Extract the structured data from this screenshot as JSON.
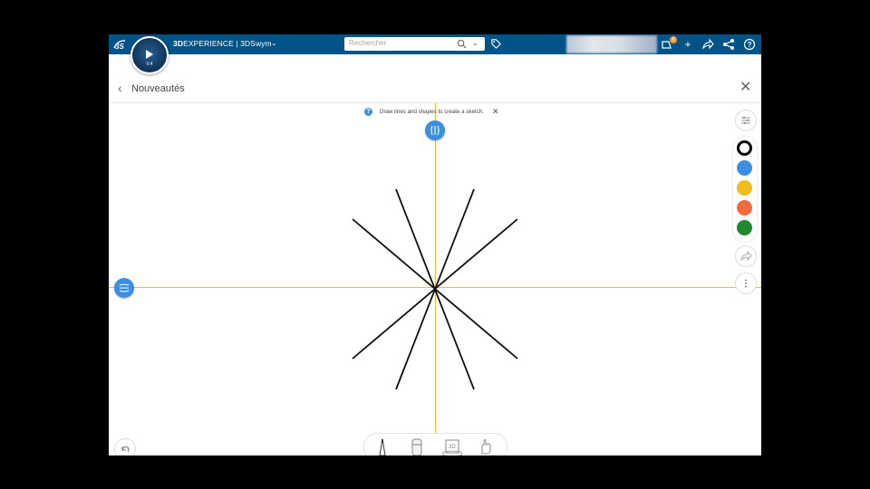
{
  "topbar": {
    "compass_tag": "V.4",
    "brand_bold": "3D",
    "brand_rest": "EXPERIENCE | 3DSwym",
    "search_placeholder": "Rechercher",
    "notification_count": "8"
  },
  "header": {
    "title": "Nouveautés"
  },
  "canvas": {
    "hint_text": "Draw lines and shapes to create a sketch.",
    "palette_colors": [
      "#000000",
      "#3b8ee2",
      "#f5bb1b",
      "#f26b3a",
      "#1f8a2c"
    ],
    "axis_color": "#f2b94a",
    "accent_color": "#3b8ee2"
  },
  "toolbar": {
    "tools": [
      "pencil",
      "eraser",
      "3d-shape",
      "hand"
    ],
    "tool_3d_label": "3D"
  }
}
